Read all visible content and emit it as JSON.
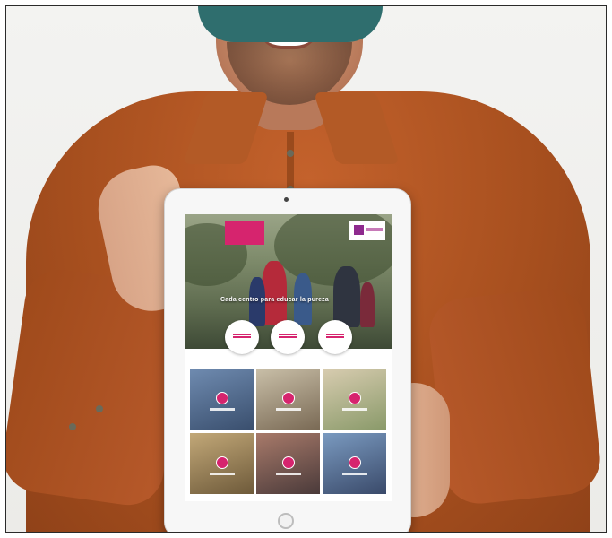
{
  "scene": {
    "subject": "",
    "colors": {
      "shirt": "#a8501f",
      "beanie": "#2f6e6e",
      "accent_pink": "#d6246e",
      "background": "#ecebe8"
    }
  },
  "tablet_page": {
    "hero_title": "Cada centro para educar la pureza",
    "circle_buttons": [
      "",
      "",
      ""
    ],
    "tiles": [
      {
        "label": ""
      },
      {
        "label": ""
      },
      {
        "label": ""
      },
      {
        "label": ""
      },
      {
        "label": ""
      },
      {
        "label": ""
      }
    ]
  }
}
